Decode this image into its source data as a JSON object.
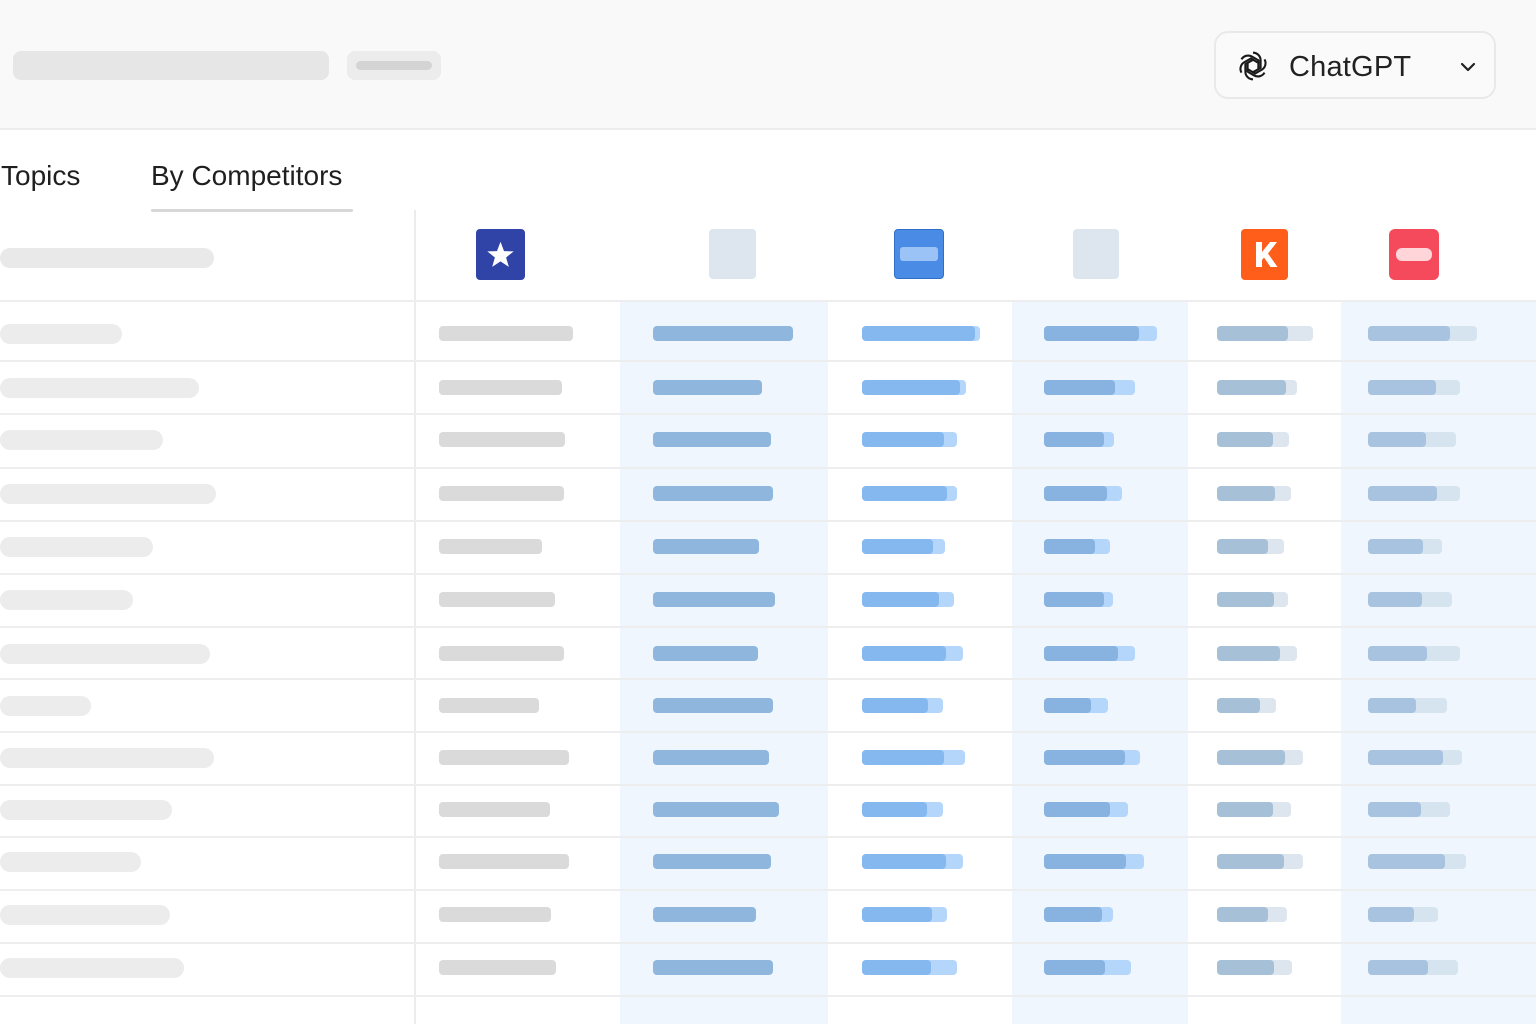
{
  "header": {
    "model_selector": {
      "label": "ChatGPT",
      "icon": "openai-logo-icon",
      "dropdown_icon": "chevron-down-icon"
    }
  },
  "tabs": [
    {
      "label": "Topics",
      "active": false
    },
    {
      "label": "By Competitors",
      "active": true
    }
  ],
  "competitors": [
    {
      "icon": "star-logo-icon",
      "color": "#3043a6"
    },
    {
      "icon": "placeholder-logo-icon",
      "color": "#dde6ee"
    },
    {
      "icon": "blue-badge-logo-icon",
      "color": "#4a8be6"
    },
    {
      "icon": "placeholder-logo-icon",
      "color": "#dde6ee"
    },
    {
      "icon": "k-letter-logo-icon",
      "color": "#fe5d1a"
    },
    {
      "icon": "red-badge-logo-icon",
      "color": "#f54a5c"
    }
  ],
  "colors": {
    "header_bg": "#f9f9f9",
    "highlight_column": "#f0f6fd",
    "bar_column_1": "#8fb7de",
    "bar_column_2": "#86b8f0",
    "bar_column_2_light": "#b4d6fb",
    "bar_column_3": "#88b3e0",
    "bar_column_3_light": "#b4d6fb",
    "bar_column_4": "#a6c0d8",
    "bar_column_4_light": "#dde6ee",
    "bar_column_5": "#a7c3df",
    "bar_column_5_light": "#d6e4f0"
  }
}
